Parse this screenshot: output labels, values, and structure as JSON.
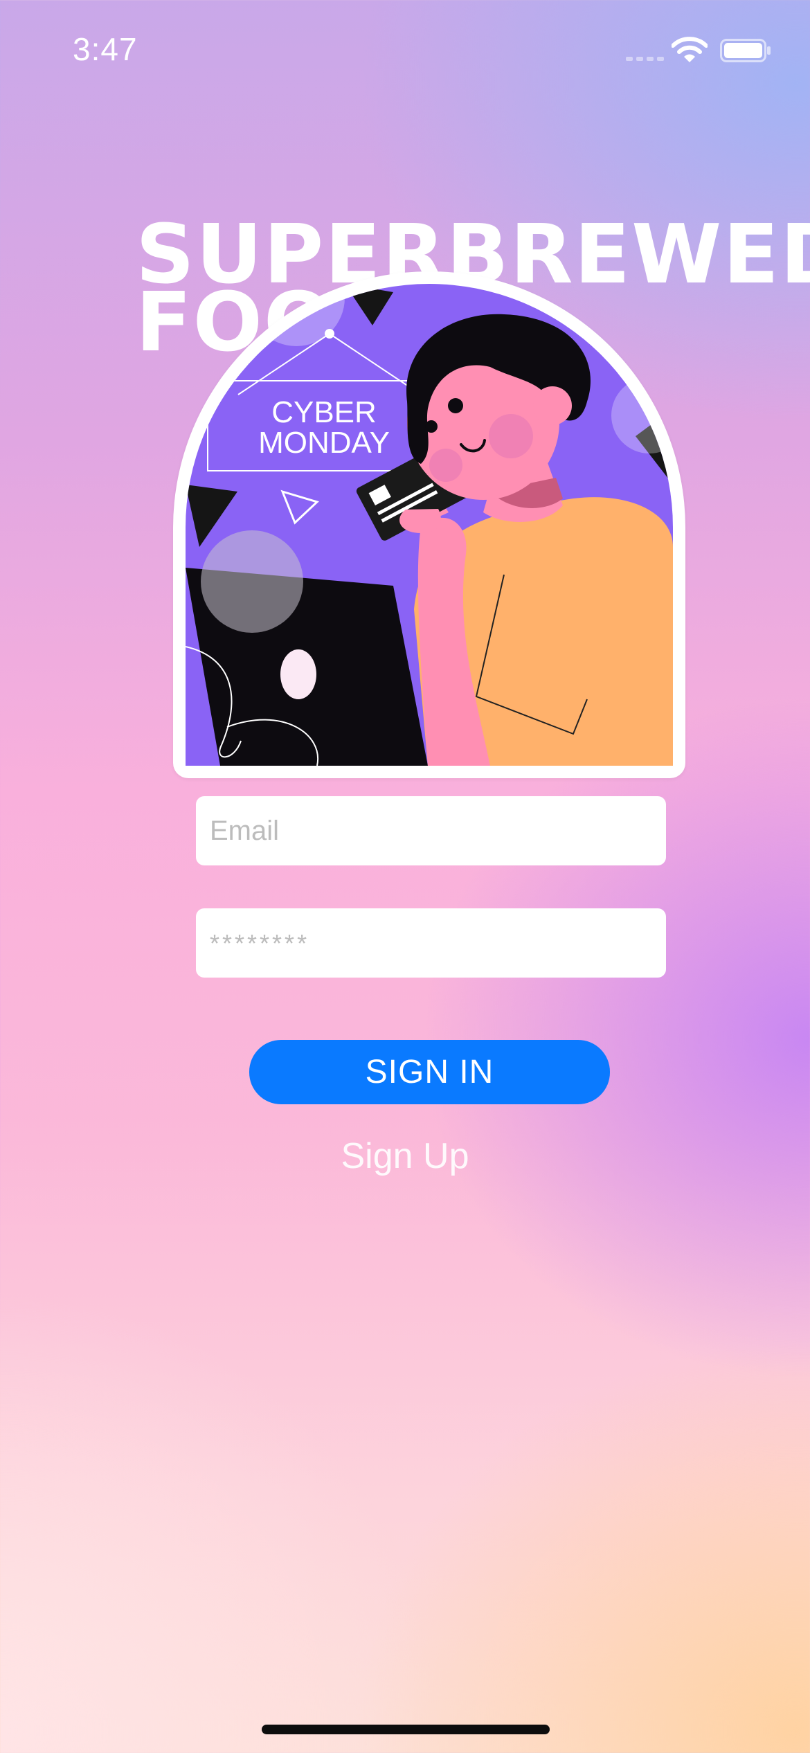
{
  "status_bar": {
    "time": "3:47",
    "icons": [
      "cellular-signal-icon",
      "wifi-icon",
      "battery-icon"
    ]
  },
  "brand": {
    "title": "SUPERBREWED\nFOOD"
  },
  "hero": {
    "sign_text_line1": "CYBER",
    "sign_text_line2": "MONDAY"
  },
  "form": {
    "email_placeholder": "Email",
    "password_placeholder": "********",
    "signin_label": "SIGN IN",
    "signup_label": "Sign Up"
  },
  "colors": {
    "primary_button": "#0a7aff",
    "illustration_bg": "#8a63f5"
  }
}
